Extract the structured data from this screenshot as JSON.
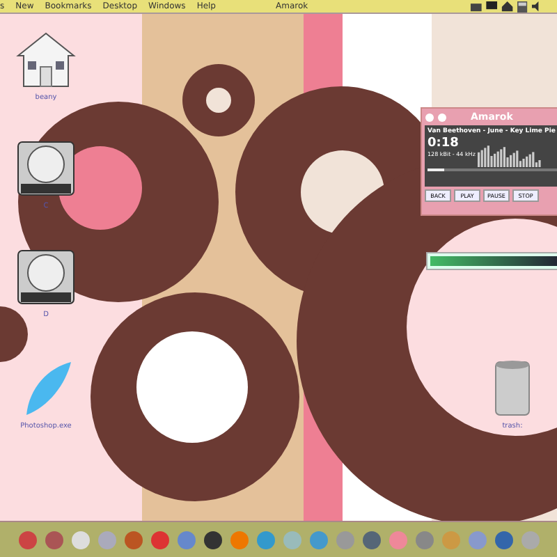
{
  "menu_bar": {
    "items": [
      "s",
      "New",
      "Bookmarks",
      "Desktop",
      "Windows",
      "Help"
    ],
    "title": "Amarok"
  },
  "desktop_icons": [
    {
      "kind": "house",
      "label": "beany"
    },
    {
      "kind": "drive",
      "label": "C"
    },
    {
      "kind": "drive",
      "label": "D"
    },
    {
      "kind": "feather",
      "label": "Photoshop.exe"
    },
    {
      "kind": "trash",
      "label": "trash:"
    }
  ],
  "player": {
    "title": "Amarok",
    "track": "Van Beethoven - June - Key Lime Pie",
    "time": "0:18",
    "bitrate": "128 kBit - 44 kHz",
    "level": 0.12,
    "buttons": [
      "BACK",
      "PLAY",
      "PAUSE",
      "STOP"
    ]
  }
}
